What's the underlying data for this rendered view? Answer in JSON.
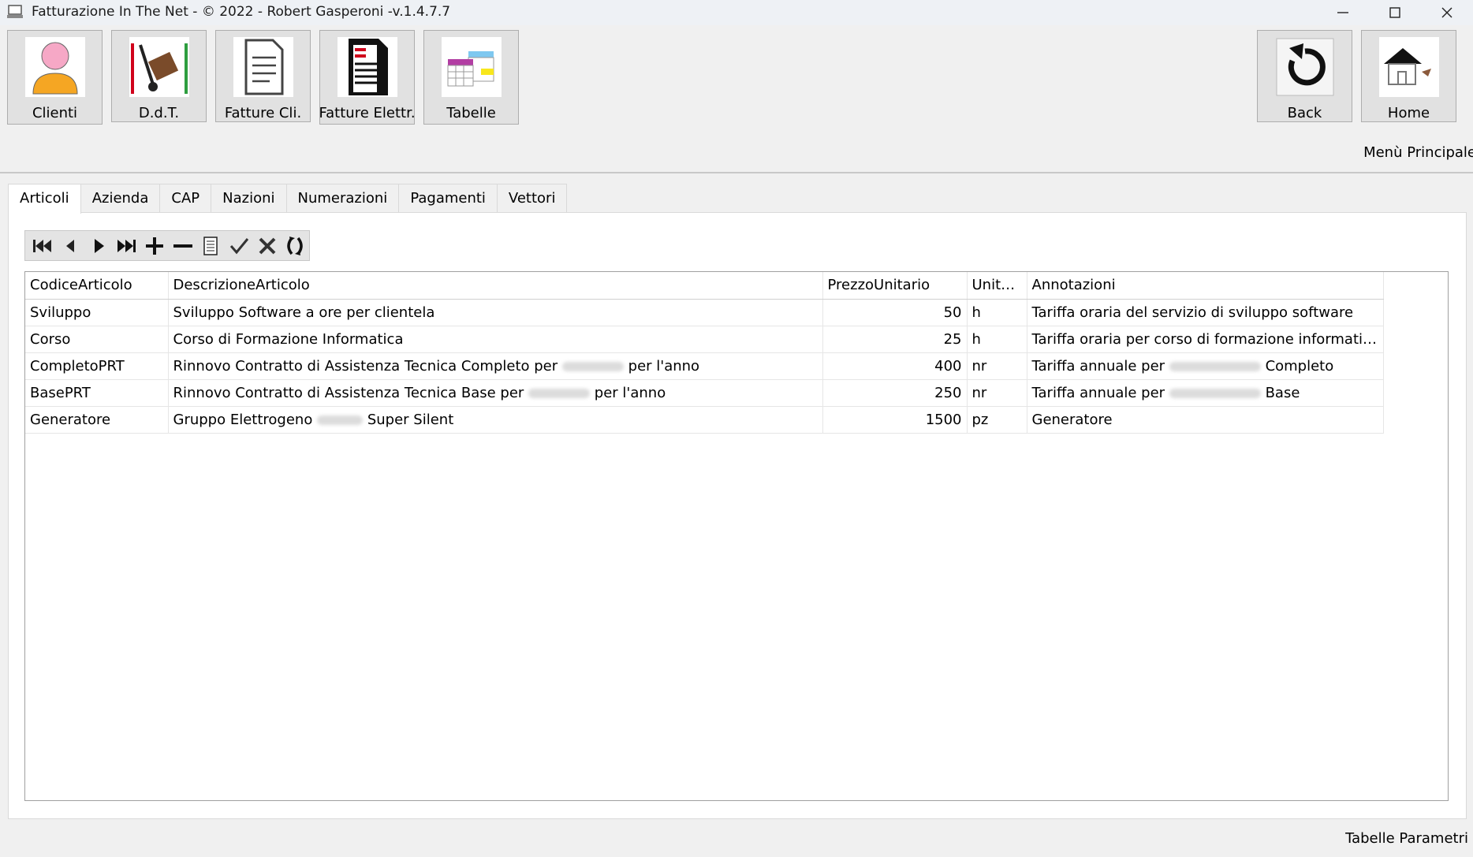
{
  "window": {
    "title": "Fatturazione In The Net - © 2022 - Robert Gasperoni -v.1.4.7.7"
  },
  "toolbar": {
    "buttons": [
      {
        "label": "Clienti",
        "icon": "person-icon"
      },
      {
        "label": "D.d.T.",
        "icon": "hand-truck-icon"
      },
      {
        "label": "Fatture Cli.",
        "icon": "document-icon"
      },
      {
        "label": "Fatture Elettr.",
        "icon": "e-invoice-icon"
      },
      {
        "label": "Tabelle",
        "icon": "tables-icon"
      }
    ],
    "right_buttons": [
      {
        "label": "Back",
        "icon": "back-arrow-icon"
      },
      {
        "label": "Home",
        "icon": "home-icon"
      }
    ]
  },
  "menu_label": "Menù Principale",
  "tabs": [
    "Articoli",
    "Azienda",
    "CAP",
    "Nazioni",
    "Numerazioni",
    "Pagamenti",
    "Vettori"
  ],
  "active_tab": "Articoli",
  "navigator_icons": [
    "first-record-icon",
    "previous-record-icon",
    "next-record-icon",
    "last-record-icon",
    "add-icon",
    "delete-icon",
    "edit-icon",
    "save-icon",
    "cancel-icon",
    "refresh-icon"
  ],
  "grid": {
    "columns": [
      "CodiceArticolo",
      "DescrizioneArticolo",
      "PrezzoUnitario",
      "Unita...",
      "Annotazioni"
    ],
    "rows": [
      {
        "code": "Sviluppo",
        "desc": [
          "Sviluppo Software a ore per clientela"
        ],
        "price": "50",
        "unit": "h",
        "notes": [
          "Tariffa oraria del servizio di sviluppo software"
        ]
      },
      {
        "code": "Corso",
        "desc": [
          "Corso di Formazione Informatica"
        ],
        "price": "25",
        "unit": "h",
        "notes": [
          "Tariffa oraria per corso di formazione informatica di b..."
        ]
      },
      {
        "code": "CompletoPRT",
        "desc": [
          "Rinnovo Contratto di Assistenza Tecnica Completo per",
          "per l'anno"
        ],
        "price": "400",
        "unit": "nr",
        "notes": [
          "Tariffa annuale per",
          "Completo"
        ]
      },
      {
        "code": "BasePRT",
        "desc": [
          "Rinnovo Contratto di Assistenza Tecnica Base per",
          "per l'anno"
        ],
        "price": "250",
        "unit": "nr",
        "notes": [
          "Tariffa annuale per",
          "Base"
        ]
      },
      {
        "code": "Generatore",
        "desc": [
          "Gruppo Elettrogeno",
          "Super Silent"
        ],
        "price": "1500",
        "unit": "pz",
        "notes": [
          "Generatore"
        ]
      }
    ]
  },
  "status_text": "Tabelle Parametri"
}
